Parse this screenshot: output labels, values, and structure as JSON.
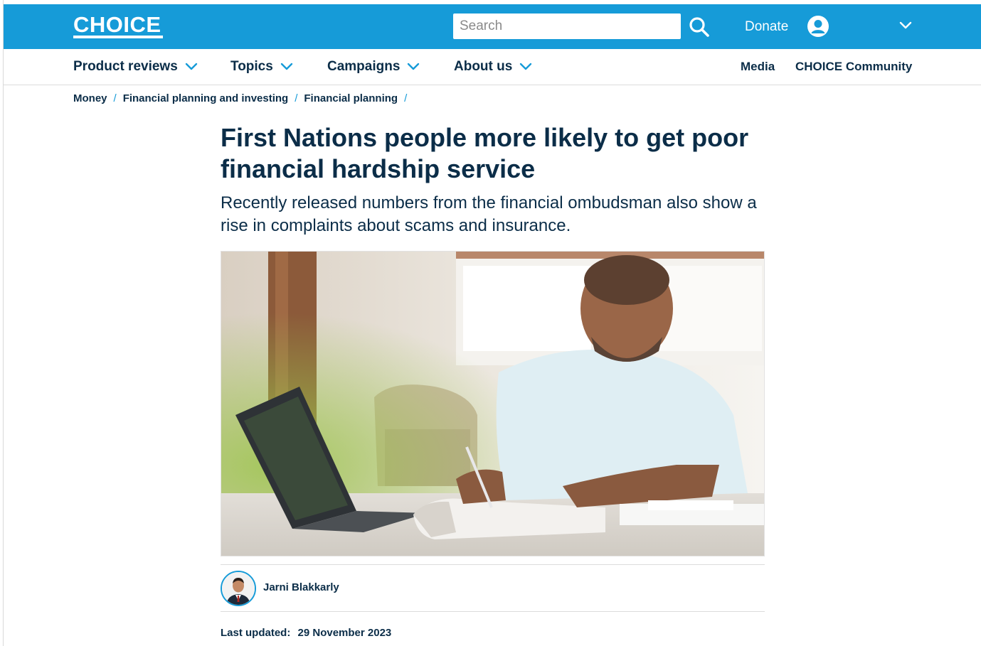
{
  "header": {
    "logo": "CHOICE",
    "search_placeholder": "Search",
    "donate": "Donate"
  },
  "nav": {
    "items": [
      {
        "label": "Product reviews"
      },
      {
        "label": "Topics"
      },
      {
        "label": "Campaigns"
      },
      {
        "label": "About us"
      }
    ],
    "links": [
      {
        "label": "Media"
      },
      {
        "label": "CHOICE Community"
      }
    ]
  },
  "breadcrumb": [
    "Money",
    "Financial planning and investing",
    "Financial planning"
  ],
  "article": {
    "title": "First Nations people more likely to get poor financial hardship service",
    "subtitle": "Recently released numbers from the financial ombudsman also show a rise in complaints about scams and insurance.",
    "author": "Jarni Blakkarly",
    "updated_label": "Last updated:",
    "updated_date": "29 November 2023"
  },
  "colors": {
    "brand_blue": "#169bd8",
    "navy": "#0b2d48"
  },
  "icons": {
    "search": "search-icon",
    "account": "user-icon",
    "chevron": "chevron-down-icon"
  }
}
